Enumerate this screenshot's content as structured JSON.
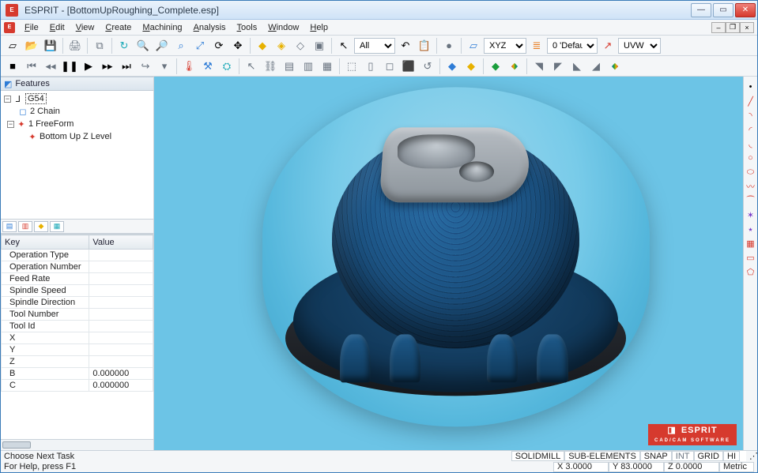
{
  "title": "ESPRIT - [BottomUpRoughing_Complete.esp]",
  "menu": [
    "File",
    "Edit",
    "View",
    "Create",
    "Machining",
    "Analysis",
    "Tools",
    "Window",
    "Help"
  ],
  "toolbar1": {
    "selects": {
      "all": "All",
      "plane": "XYZ",
      "layer": "0 'Defau",
      "uvw": "UVW"
    }
  },
  "features_panel": {
    "title": "Features",
    "tree": [
      {
        "label": "G54",
        "sel": true,
        "indent": 0
      },
      {
        "label": "2 Chain",
        "indent": 1,
        "color": "#2e7cd6"
      },
      {
        "label": "1 FreeForm",
        "indent": 1,
        "color": "#d63a2e"
      },
      {
        "label": "Bottom Up Z Level",
        "indent": 2,
        "color": "#d63a2e"
      }
    ]
  },
  "props": {
    "headers": [
      "Key",
      "Value"
    ],
    "rows": [
      [
        "Operation Type",
        ""
      ],
      [
        "Operation Number",
        ""
      ],
      [
        "Feed Rate",
        ""
      ],
      [
        "Spindle Speed",
        ""
      ],
      [
        "Spindle Direction",
        ""
      ],
      [
        "Tool Number",
        ""
      ],
      [
        "Tool Id",
        ""
      ],
      [
        "X",
        ""
      ],
      [
        "Y",
        ""
      ],
      [
        "Z",
        ""
      ],
      [
        "B",
        "0.000000"
      ],
      [
        "C",
        "0.000000"
      ]
    ]
  },
  "brand": {
    "name": "ESPRIT",
    "sub": "CAD/CAM SOFTWARE"
  },
  "status": {
    "left1": "Choose Next Task",
    "left2": "For Help, press F1",
    "cells": [
      "SOLIDMILL",
      "SUB-ELEMENTS",
      "SNAP",
      "INT",
      "GRID",
      "HI"
    ],
    "coords": {
      "x": "X 3.0000",
      "y": "Y 83.0000",
      "z": "Z 0.0000"
    },
    "units": "Metric"
  }
}
